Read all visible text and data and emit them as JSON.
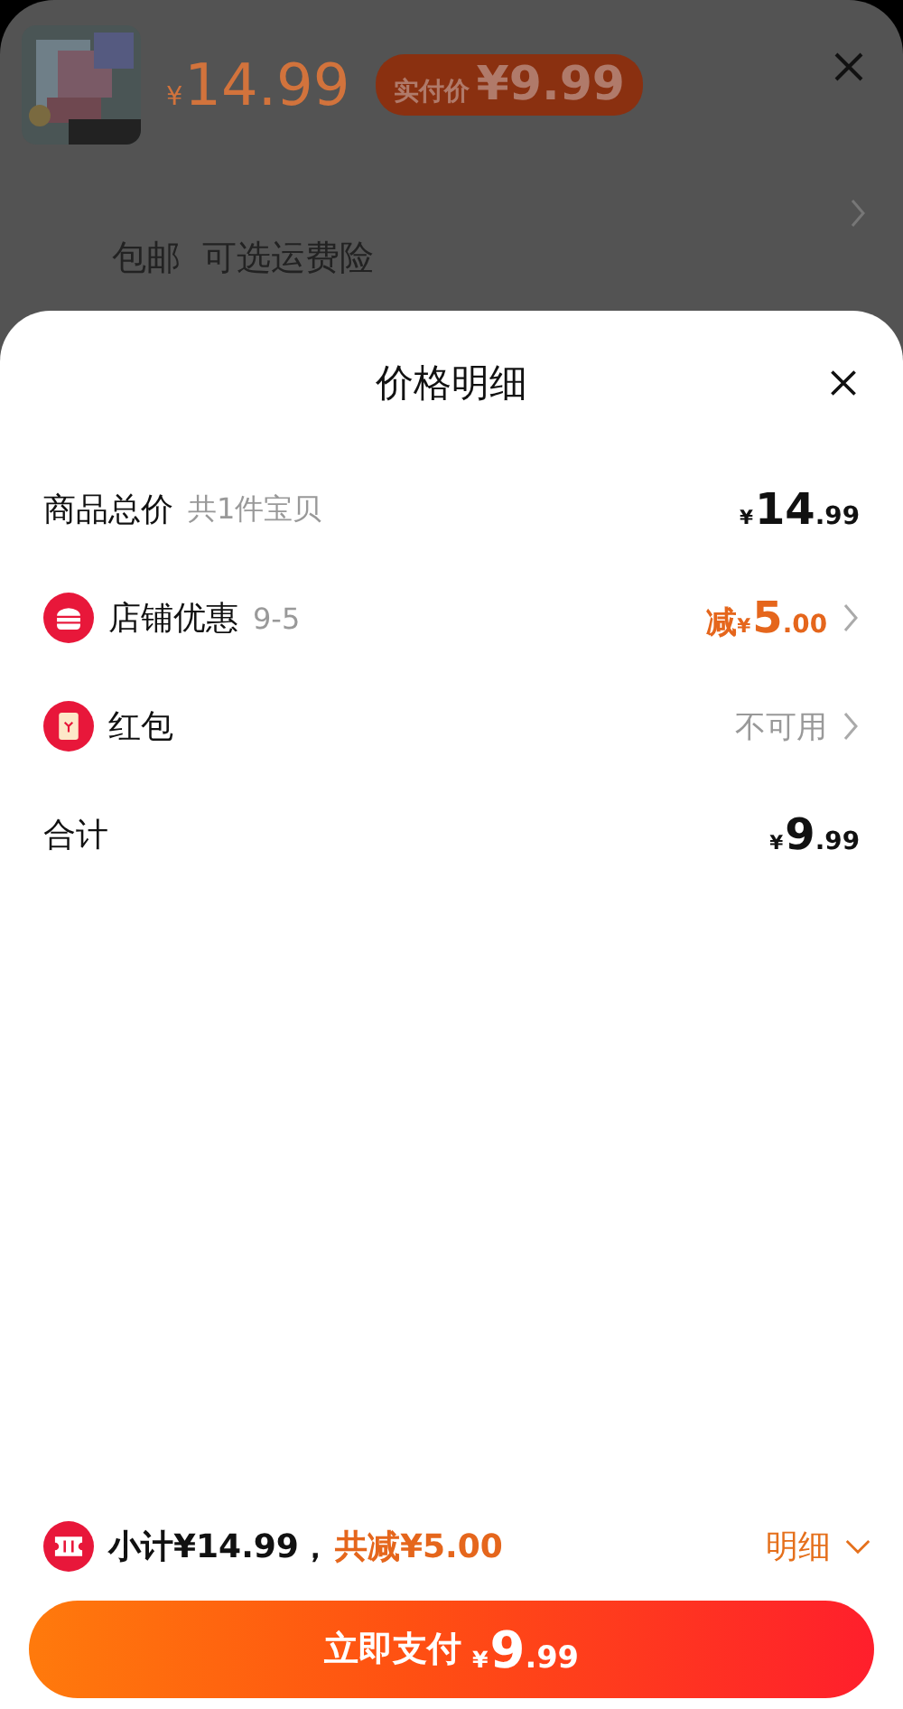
{
  "product_sheet": {
    "price": "¥14.99",
    "badge_label": "实付价",
    "badge_price": "¥9.99",
    "shipping": "包邮  可选运费险"
  },
  "price_detail": {
    "title": "价格明细",
    "rows": [
      {
        "kind": "total",
        "label": "商品总价",
        "note": "共1件宝贝",
        "value": "¥14.99",
        "color": "#111111",
        "has_arrow": false
      },
      {
        "kind": "shop",
        "label": "店铺优惠",
        "note": "9-5",
        "prefix": "减",
        "value": "¥5.00",
        "color": "#e5661c",
        "has_arrow": true
      },
      {
        "kind": "packet",
        "label": "红包",
        "value": "不可用",
        "color": "#999999",
        "has_arrow": true
      },
      {
        "kind": "sum",
        "label": "合计",
        "value": "¥9.99",
        "color": "#111111",
        "has_arrow": false
      }
    ],
    "footer": {
      "subtotal": "小计¥14.99，",
      "saved": "共减¥5.00",
      "detail_link": "明细",
      "expanded": false
    },
    "pay_button": {
      "label": "立即支付",
      "price": "¥9.99"
    }
  }
}
